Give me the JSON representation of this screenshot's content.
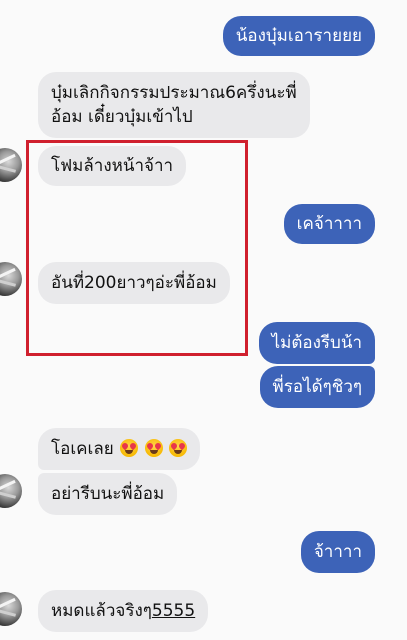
{
  "messages": [
    {
      "id": "m1",
      "side": "outgoing",
      "text": "น้องบุ๋มเอารายยย"
    },
    {
      "id": "m2",
      "side": "incoming",
      "line1": "บุ๋มเลิกกิจกรรมประมาณ6ครึ่งนะพี่",
      "line2": "อ้อม เดี๋ยวบุ๋มเข้าไป"
    },
    {
      "id": "m3",
      "side": "incoming",
      "text": "โฟมล้างหน้าจ้าา"
    },
    {
      "id": "m4",
      "side": "outgoing",
      "text": "เคจ้าาาา"
    },
    {
      "id": "m5",
      "side": "incoming",
      "text": "อันที่200ยาวๆอ่ะพี่อ้อม"
    },
    {
      "id": "m6",
      "side": "outgoing",
      "text": "ไม่ต้องรีบน้า"
    },
    {
      "id": "m7",
      "side": "outgoing",
      "text": "พี่รอได้ๆชิวๆ"
    },
    {
      "id": "m8",
      "side": "incoming",
      "text": "โอเคเลย"
    },
    {
      "id": "m9",
      "side": "incoming",
      "text": "อย่ารีบนะพี่อ้อม"
    },
    {
      "id": "m10",
      "side": "outgoing",
      "text": "จ้าาาา"
    },
    {
      "id": "m11",
      "side": "incoming",
      "text": "หมดแล้วจริงๆ",
      "text_underlined": "5555"
    }
  ],
  "colors": {
    "outgoing_bubble": "#3d63b8",
    "incoming_bubble": "#e9e9eb",
    "highlight_box": "#d0202e"
  },
  "icons": {
    "avatar": "contact-avatar",
    "emoji": "smiling-face-with-heart-eyes-icon"
  }
}
